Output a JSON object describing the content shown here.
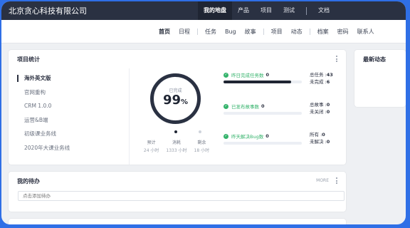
{
  "topbar": {
    "brand": "北京贪心科技有限公司",
    "nav": [
      "我的地盘",
      "产品",
      "项目",
      "测试"
    ],
    "doc": "文档"
  },
  "subnav": {
    "items": [
      "首页",
      "日程",
      "任务",
      "Bug",
      "故事",
      "项目",
      "动态",
      "档案",
      "密码",
      "联系人"
    ]
  },
  "project_stats": {
    "title": "项目统计",
    "projects": [
      "海外英文版",
      "官网重构",
      "CRM 1.0.0",
      "运营&B端",
      "初级课业务线",
      "2020年大课业务线"
    ],
    "ring": {
      "label": "已完成",
      "percent": "99",
      "symbol": "%",
      "value": 0.99
    },
    "metrics": [
      {
        "label": "预计",
        "value": "24 小时"
      },
      {
        "label": "消耗",
        "value": "1333 小时"
      },
      {
        "label": "剩余",
        "value": "18 小时"
      }
    ],
    "stats": [
      {
        "text": "昨日完成任务数",
        "count": "0",
        "progress": 0.86,
        "k1": "总任务 :",
        "v1": "43",
        "k2": "未完成 :",
        "v2": "6"
      },
      {
        "text": "已发布故事数",
        "count": "0",
        "progress": 0,
        "k1": "总故事 :",
        "v1": "0",
        "k2": "未关闭 :",
        "v2": "0"
      },
      {
        "text": "昨天解决Bug数",
        "count": "0",
        "progress": 0,
        "k1": "所有 :",
        "v1": "0",
        "k2": "未解决 :",
        "v2": "0"
      }
    ]
  },
  "latest": {
    "title": "最新动态"
  },
  "todo": {
    "title": "我的待办",
    "more": "MORE",
    "placeholder": "点击添加待办"
  },
  "colors": {
    "topbar": "#2a3142",
    "accent": "#1f2533",
    "success": "#34b36b",
    "frame": "#2f6fe6"
  }
}
